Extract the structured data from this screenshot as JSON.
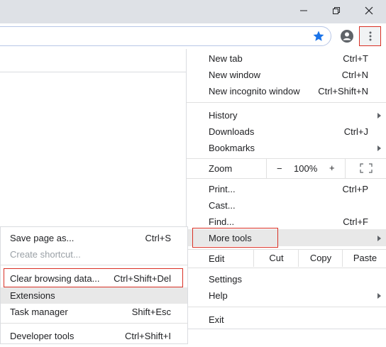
{
  "window": {
    "minimize_icon": "minimize-icon",
    "maximize_icon": "restore-icon",
    "close_icon": "close-icon"
  },
  "toolbar": {
    "star_icon": "bookmark-star-icon",
    "star_color": "#1a73e8",
    "avatar_icon": "profile-avatar-icon",
    "menu_icon": "three-dots-vertical-icon"
  },
  "menu": {
    "new_tab": {
      "label": "New tab",
      "shortcut": "Ctrl+T"
    },
    "new_window": {
      "label": "New window",
      "shortcut": "Ctrl+N"
    },
    "new_incognito": {
      "label": "New incognito window",
      "shortcut": "Ctrl+Shift+N"
    },
    "history": {
      "label": "History"
    },
    "downloads": {
      "label": "Downloads",
      "shortcut": "Ctrl+J"
    },
    "bookmarks": {
      "label": "Bookmarks"
    },
    "zoom": {
      "label": "Zoom",
      "minus": "−",
      "value": "100%",
      "plus": "+"
    },
    "print": {
      "label": "Print...",
      "shortcut": "Ctrl+P"
    },
    "cast": {
      "label": "Cast..."
    },
    "find": {
      "label": "Find...",
      "shortcut": "Ctrl+F"
    },
    "more_tools": {
      "label": "More tools"
    },
    "edit": {
      "label": "Edit",
      "cut": "Cut",
      "copy": "Copy",
      "paste": "Paste"
    },
    "settings": {
      "label": "Settings"
    },
    "help": {
      "label": "Help"
    },
    "exit": {
      "label": "Exit"
    }
  },
  "submenu": {
    "save_page": {
      "label": "Save page as...",
      "shortcut": "Ctrl+S"
    },
    "create_shortcut": {
      "label": "Create shortcut..."
    },
    "clear_data": {
      "label": "Clear browsing data...",
      "shortcut": "Ctrl+Shift+Del"
    },
    "extensions": {
      "label": "Extensions"
    },
    "task_manager": {
      "label": "Task manager",
      "shortcut": "Shift+Esc"
    },
    "developer_tools": {
      "label": "Developer tools",
      "shortcut": "Ctrl+Shift+I"
    }
  },
  "colors": {
    "highlight_border": "#d93025",
    "hover_bg": "#e8e8e8",
    "titlebar_bg": "#dee1e6"
  }
}
